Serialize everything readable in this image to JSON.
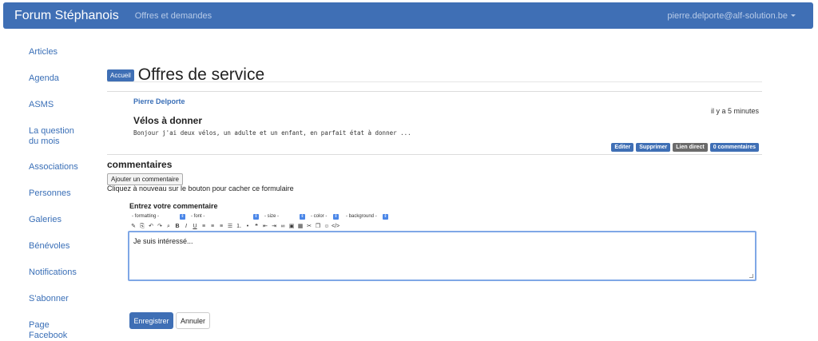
{
  "navbar": {
    "brand": "Forum Stéphanois",
    "link": "Offres et demandes",
    "user": "pierre.delporte@alf-solution.be"
  },
  "sidebar": {
    "items": [
      {
        "label": "Articles"
      },
      {
        "label": "Agenda"
      },
      {
        "label": "ASMS"
      },
      {
        "label": "La question du mois"
      },
      {
        "label": "Associations"
      },
      {
        "label": "Personnes"
      },
      {
        "label": "Galeries"
      },
      {
        "label": "Bénévoles"
      },
      {
        "label": "Notifications"
      },
      {
        "label": "S'abonner"
      },
      {
        "label": "Page Facebook"
      }
    ]
  },
  "main": {
    "badge": "Accueil",
    "title": "Offres de service",
    "post": {
      "author": "Pierre Delporte",
      "time": "il y a 5 minutes",
      "title": "Vélos à donner",
      "body": "Bonjour j'ai deux vélos, un adulte et un enfant, en parfait état à donner ...",
      "actions": {
        "edit": "Editer",
        "delete": "Supprimer",
        "direct_link": "Lien direct",
        "comments": "0 commentaires"
      }
    },
    "comments_heading": "commentaires",
    "add_comment_button": "Ajouter un commentaire",
    "hint": "Cliquez à nouveau sur le bouton pour cacher ce formulaire",
    "editor": {
      "label": "Entrez votre commentaire",
      "dropdowns": {
        "formatting": "- formatting -",
        "font": "- font -",
        "size": "- size -",
        "color": "- color -",
        "background": "- background -"
      },
      "value": "Je suis intéressé..."
    },
    "save_button": "Enregistrer",
    "cancel_button": "Annuler"
  },
  "colors": {
    "primary": "#3f6fb5",
    "link": "#3a6fb7"
  }
}
